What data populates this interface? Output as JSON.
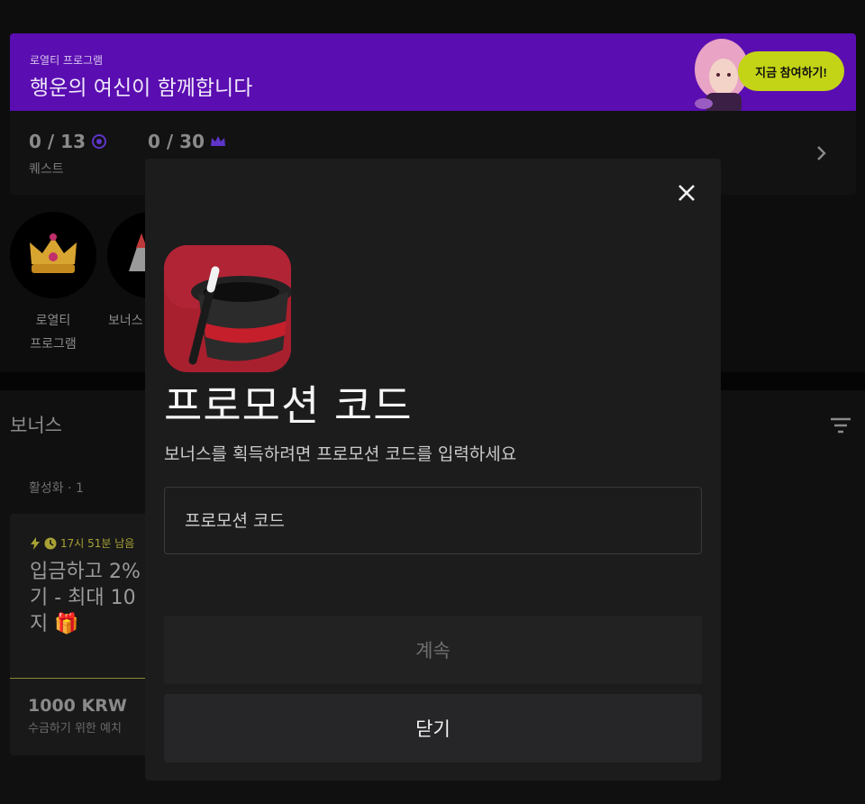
{
  "banner": {
    "small_label": "로열티 프로그램",
    "title": "행운의 여신이 함께합니다",
    "cta_label": "지금 참여하기!",
    "colors": {
      "background": "#5a0db0",
      "cta": "#c3d416"
    }
  },
  "stats": {
    "quests_value": "0 / 13",
    "quests_label": "퀘스트",
    "crowns_value": "0 / 30"
  },
  "shortcuts": [
    {
      "label": "로열티\n프로그램",
      "icon": "crown-icon"
    },
    {
      "label": "보너스",
      "icon": "bonus-icon"
    }
  ],
  "bonus_section": {
    "title": "보너스",
    "active_label": "활성화 · 1",
    "card": {
      "timer": "17시 51분 남음",
      "title": "입금하고 2%\n기 - 최대 10\n지 🎁",
      "amount": "1000 KRW",
      "desc": "수금하기 위한 예치"
    }
  },
  "modal": {
    "title": "프로모션 코드",
    "subtitle": "보너스를 획득하려면 프로모션 코드를 입력하세요",
    "input": {
      "placeholder": "프로모션 코드",
      "value": ""
    },
    "continue_label": "계속",
    "close_label": "닫기"
  }
}
